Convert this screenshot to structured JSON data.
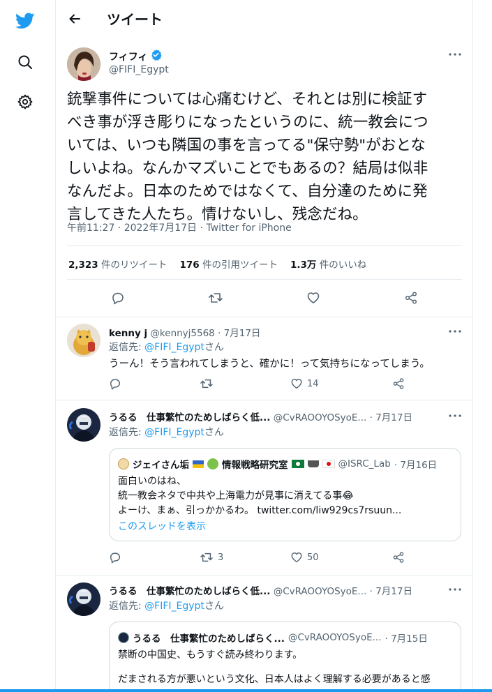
{
  "nav": {
    "logo": "twitter-bird-icon",
    "search": "search-icon",
    "settings": "gear-icon"
  },
  "header": {
    "title": "ツイート"
  },
  "tweet": {
    "author_name": "フィフィ",
    "author_handle": "@FIFI_Egypt",
    "verified": true,
    "text_lines": [
      "銃撃事件については心痛むけど、それとは別に検証す",
      "べき事が浮き彫りになったというのに、統一教会につ",
      "いては、いつも隣国の事を言ってる\"保守勢\"がおとな",
      "しいよね。なんかマズいことでもあるの？結局は似非",
      "なんだよ。日本のためではなくて、自分達のために発",
      "言してきた人たち。情けないし、残念だね。"
    ],
    "meta": "午前11:27 · 2022年7月17日 · Twitter for iPhone",
    "stats": {
      "retweets_num": "2,323",
      "retweets_label": "件のリツイート",
      "quotes_num": "176",
      "quotes_label": "件の引用ツイート",
      "likes_num": "1.3万",
      "likes_label": "件のいいね"
    }
  },
  "replies": [
    {
      "name": "kenny j",
      "handle": "@kennyj5568",
      "date": "· 7月17日",
      "reply_to_prefix": "返信先: ",
      "reply_to_handle": "@FIFI_Egypt",
      "reply_to_suffix": "さん",
      "text": "うーん！そう言われてしまうと、確かに！って気持ちになってしまう。",
      "retweets": "",
      "likes": "14"
    },
    {
      "name": "うるる　仕事繁忙のためしばらく低...",
      "handle": "@CvRAOOYOSyoE...",
      "date": "· 7月17日",
      "reply_to_prefix": "返信先: ",
      "reply_to_handle": "@FIFI_Egypt",
      "reply_to_suffix": "さん",
      "retweets": "3",
      "likes": "50",
      "quote": {
        "name": "ジェイさん垢",
        "name2": "情報戦略研究室",
        "handle": "@ISRC_Lab",
        "date": "· 7月16日",
        "lines": [
          "面白いのはね、",
          "統一教会ネタで中共や上海電力が見事に消えてる事😂",
          "よーけ、まぁ、引っかかるわ。 twitter.com/liw929cs7rsuun..."
        ],
        "thread_link": "このスレッドを表示"
      }
    },
    {
      "name": "うるる　仕事繁忙のためしばらく低...",
      "handle": "@CvRAOOYOSyoE...",
      "date": "· 7月17日",
      "reply_to_prefix": "返信先: ",
      "reply_to_handle": "@FIFI_Egypt",
      "reply_to_suffix": "さん",
      "quote": {
        "name": "うるる　仕事繁忙のためしばらく...",
        "handle": "@CvRAOOYOSyoE...",
        "date": "· 7月15日",
        "lines": [
          "禁断の中国史、もうすぐ読み終わります。",
          "",
          "だまされる方が悪いという文化、日本人はよく理解する必要があると感"
        ]
      }
    }
  ],
  "colors": {
    "accent": "#1d9bf0",
    "text": "#0f1419",
    "muted": "#536471",
    "border": "#e6ecf0"
  }
}
